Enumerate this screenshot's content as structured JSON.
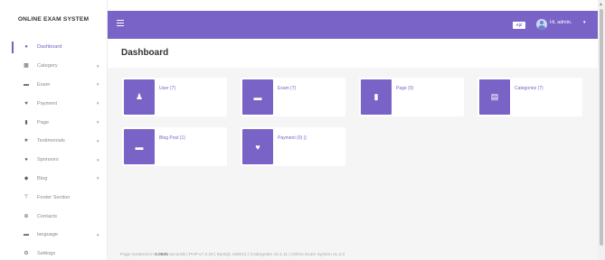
{
  "app": {
    "brand": "ONLINE EXAM SYSTEM",
    "accent_color": "#7a63c7"
  },
  "sidebar": {
    "items": [
      {
        "label": "Dashboard",
        "icon": "dashboard-icon",
        "active": true,
        "has_submenu": false
      },
      {
        "label": "Category",
        "icon": "category-icon",
        "active": false,
        "has_submenu": true
      },
      {
        "label": "Exam",
        "icon": "exam-icon",
        "active": false,
        "has_submenu": true
      },
      {
        "label": "Payment",
        "icon": "payment-icon",
        "active": false,
        "has_submenu": true
      },
      {
        "label": "Page",
        "icon": "page-icon",
        "active": false,
        "has_submenu": true
      },
      {
        "label": "Testimonials",
        "icon": "star-icon",
        "active": false,
        "has_submenu": true
      },
      {
        "label": "Sponsors",
        "icon": "sponsors-icon",
        "active": false,
        "has_submenu": true
      },
      {
        "label": "Blog",
        "icon": "blog-icon",
        "active": false,
        "has_submenu": true
      },
      {
        "label": "Footer Section",
        "icon": "footer-icon",
        "active": false,
        "has_submenu": false
      },
      {
        "label": "Contacts",
        "icon": "contacts-icon",
        "active": false,
        "has_submenu": false
      },
      {
        "label": "language",
        "icon": "language-icon",
        "active": false,
        "has_submenu": true
      },
      {
        "label": "Settings",
        "icon": "settings-icon",
        "active": false,
        "has_submenu": false
      }
    ]
  },
  "topbar": {
    "lang_badge": "A|Z",
    "user_label": "Hi, admin."
  },
  "main": {
    "title": "Dashboard",
    "cards": [
      {
        "label": "User (7)",
        "icon": "user-icon"
      },
      {
        "label": "Exam (7)",
        "icon": "exam-card-icon"
      },
      {
        "label": "Page (0)",
        "icon": "file-icon"
      },
      {
        "label": "Categories (7)",
        "icon": "categories-icon"
      },
      {
        "label": "Blog Post (1)",
        "icon": "blog-post-icon"
      },
      {
        "label": "Payment (0) ()",
        "icon": "payment-hand-icon"
      }
    ]
  },
  "footer": {
    "prefix": "Page rendered in ",
    "time": "0.0925",
    "suffix": " seconds | PHP v7.3.28 | MySQL v50013 | CodeIgniter v3.1.11 | Online Exam System v1.2.0"
  }
}
